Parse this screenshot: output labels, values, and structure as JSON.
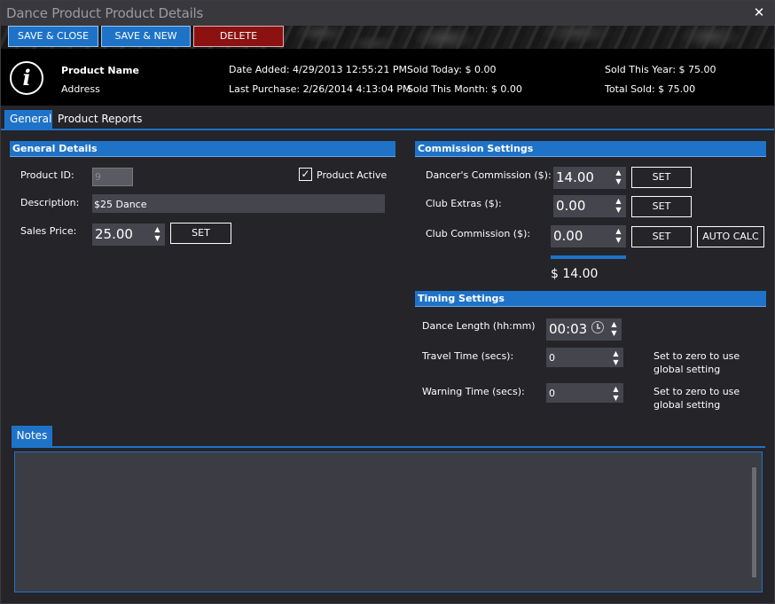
{
  "window": {
    "title": "Dance Product Product Details",
    "close_glyph": "✕"
  },
  "toolbar": {
    "save_close": "SAVE & CLOSE",
    "save_new": "SAVE & NEW",
    "delete": "DELETE"
  },
  "info": {
    "icon_glyph": "i",
    "product_name": "Product Name",
    "address": "Address",
    "date_added": "Date Added: 4/29/2013 12:55:21 PM",
    "last_purchase": "Last Purchase: 2/26/2014 4:13:04 PM",
    "sold_today": "Sold Today: $ 0.00",
    "sold_month": "Sold This Month: $ 0.00",
    "sold_year": "Sold This Year: $ 75.00",
    "total_sold": "Total Sold: $ 75.00"
  },
  "tabs": [
    {
      "label": "General"
    },
    {
      "label": "Product Reports"
    }
  ],
  "general": {
    "header": "General Details",
    "product_id_label": "Product ID:",
    "product_id_value": "9",
    "product_active_label": "Product Active",
    "product_active_checked": "✓",
    "description_label": "Description:",
    "description_value": "$25 Dance",
    "sales_price_label": "Sales Price:",
    "sales_price_value": "25.00",
    "set_label": "SET"
  },
  "commission": {
    "header": "Commission Settings",
    "dancer_label": "Dancer's Commission ($):",
    "dancer_value": "14.00",
    "club_extras_label": "Club Extras ($):",
    "club_extras_value": "0.00",
    "club_commission_label": "Club Commission ($):",
    "club_commission_value": "0.00",
    "set_label": "SET",
    "auto_calc": "AUTO CALC",
    "total": "$ 14.00"
  },
  "timing": {
    "header": "Timing Settings",
    "dance_length_label": "Dance Length (hh:mm)",
    "dance_length_value": "00:03",
    "travel_label": "Travel Time (secs):",
    "travel_value": "0",
    "travel_hint_1": "Set to zero to use",
    "travel_hint_2": "global setting",
    "warning_label": "Warning Time (secs):",
    "warning_value": "0",
    "warning_hint_1": "Set to zero to use",
    "warning_hint_2": "global setting"
  },
  "notes": {
    "tab_label": "Notes",
    "value": ""
  },
  "spinner": {
    "up": "▲",
    "down": "▼"
  },
  "colors": {
    "accent": "#1e73c8",
    "delete": "#8c1212",
    "background": "#242429",
    "field": "#45454d"
  }
}
